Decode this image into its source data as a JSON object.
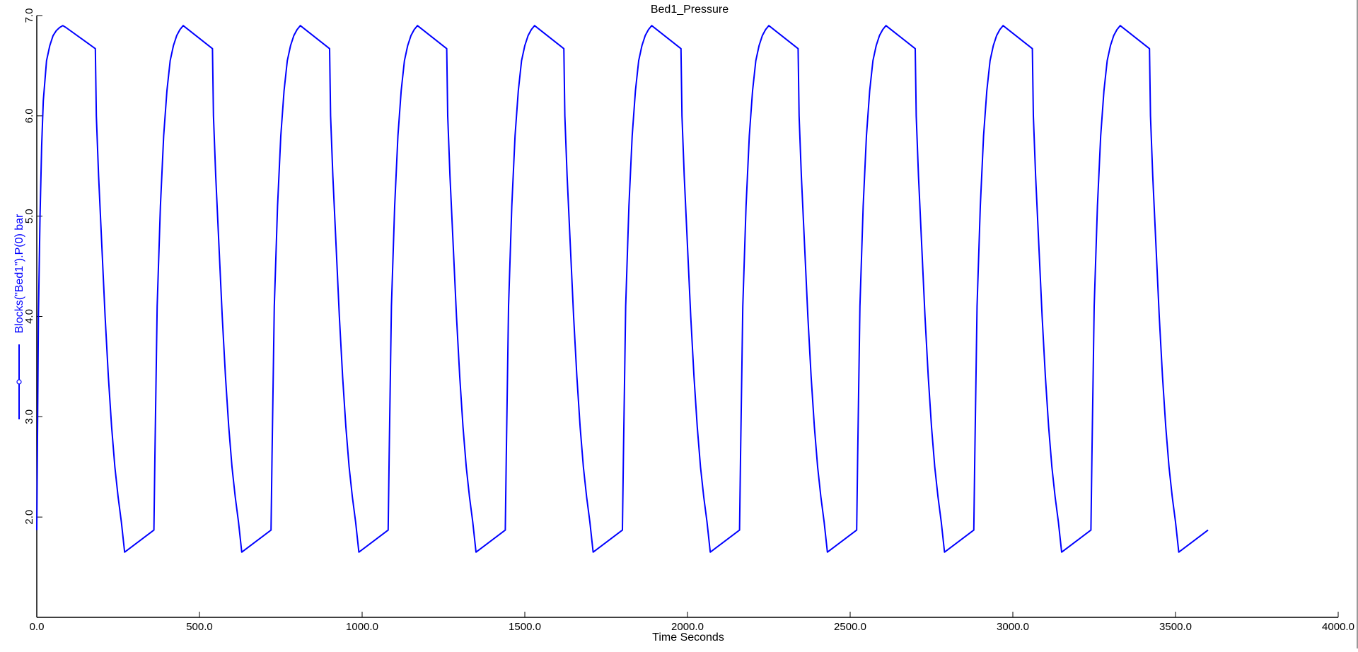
{
  "chart_data": {
    "type": "line",
    "title": "Bed1_Pressure",
    "xlabel": "Time Seconds",
    "ylabel": "Blocks(\"Bed1\").P(0) bar",
    "xlim": [
      0,
      4000
    ],
    "ylim": [
      1.0,
      7.0
    ],
    "x_ticks": [
      {
        "value": 0,
        "label": "0.0"
      },
      {
        "value": 500,
        "label": "500.0"
      },
      {
        "value": 1000,
        "label": "1000.0"
      },
      {
        "value": 1500,
        "label": "1500.0"
      },
      {
        "value": 2000,
        "label": "2000.0"
      },
      {
        "value": 2500,
        "label": "2500.0"
      },
      {
        "value": 3000,
        "label": "3000.0"
      },
      {
        "value": 3500,
        "label": "3500.0"
      },
      {
        "value": 4000,
        "label": "4000.0"
      }
    ],
    "y_ticks": [
      {
        "value": 2.0,
        "label": "2.0"
      },
      {
        "value": 3.0,
        "label": "3.0"
      },
      {
        "value": 4.0,
        "label": "4.0"
      },
      {
        "value": 5.0,
        "label": "5.0"
      },
      {
        "value": 6.0,
        "label": "6.0"
      },
      {
        "value": 7.0,
        "label": "7.0"
      }
    ],
    "grid": false,
    "series": [
      {
        "name": "Blocks(\"Bed1\").P(0) bar",
        "color": "#0000ff",
        "x": [
          0,
          2,
          5,
          10,
          15,
          20,
          30,
          40,
          50,
          60,
          70,
          80,
          90,
          180,
          183,
          190,
          200,
          210,
          220,
          230,
          240,
          250,
          260,
          270,
          360,
          363,
          370,
          380,
          390,
          400,
          410,
          420,
          430,
          440,
          450,
          540,
          543,
          550,
          560,
          570,
          580,
          590,
          600,
          610,
          620,
          630,
          720,
          723,
          730,
          740,
          750,
          760,
          770,
          780,
          790,
          800,
          810,
          900,
          903,
          910,
          920,
          930,
          940,
          950,
          960,
          970,
          980,
          990,
          1080,
          1083,
          1090,
          1100,
          1110,
          1120,
          1130,
          1140,
          1150,
          1160,
          1170,
          1260,
          1263,
          1270,
          1280,
          1290,
          1300,
          1310,
          1320,
          1330,
          1340,
          1350,
          1440,
          1443,
          1450,
          1460,
          1470,
          1480,
          1490,
          1500,
          1510,
          1520,
          1530,
          1620,
          1623,
          1630,
          1640,
          1650,
          1660,
          1670,
          1680,
          1690,
          1700,
          1710,
          1800,
          1803,
          1810,
          1820,
          1830,
          1840,
          1850,
          1860,
          1870,
          1880,
          1890,
          1980,
          1983,
          1990,
          2000,
          2010,
          2020,
          2030,
          2040,
          2050,
          2060,
          2070,
          2160,
          2163,
          2170,
          2180,
          2190,
          2200,
          2210,
          2220,
          2230,
          2240,
          2250,
          2340,
          2343,
          2350,
          2360,
          2370,
          2380,
          2390,
          2400,
          2410,
          2420,
          2430,
          2520,
          2523,
          2530,
          2540,
          2550,
          2560,
          2570,
          2580,
          2590,
          2600,
          2610,
          2700,
          2703,
          2710,
          2720,
          2730,
          2740,
          2750,
          2760,
          2770,
          2780,
          2790,
          2880,
          2883,
          2890,
          2900,
          2910,
          2920,
          2930,
          2940,
          2950,
          2960,
          2970,
          3060,
          3063,
          3070,
          3080,
          3090,
          3100,
          3110,
          3120,
          3130,
          3140,
          3150,
          3240,
          3243,
          3250,
          3260,
          3270,
          3280,
          3290,
          3300,
          3310,
          3320,
          3330,
          3420,
          3423,
          3430,
          3440,
          3450,
          3460,
          3470,
          3480,
          3490,
          3500,
          3510,
          3600
        ],
        "y": [
          1.87,
          2.7,
          4.0,
          5.0,
          5.7,
          6.15,
          6.55,
          6.7,
          6.8,
          6.85,
          6.88,
          6.9,
          6.88,
          6.67,
          6.0,
          5.4,
          4.7,
          4.0,
          3.4,
          2.9,
          2.5,
          2.2,
          1.95,
          1.65,
          1.87,
          2.6,
          4.1,
          5.1,
          5.8,
          6.25,
          6.55,
          6.7,
          6.8,
          6.86,
          6.9,
          6.67,
          6.0,
          5.4,
          4.7,
          4.0,
          3.4,
          2.9,
          2.5,
          2.2,
          1.95,
          1.65,
          1.87,
          2.6,
          4.1,
          5.1,
          5.8,
          6.25,
          6.55,
          6.7,
          6.8,
          6.86,
          6.9,
          6.67,
          6.0,
          5.4,
          4.7,
          4.0,
          3.4,
          2.9,
          2.5,
          2.2,
          1.95,
          1.65,
          1.87,
          2.6,
          4.1,
          5.1,
          5.8,
          6.25,
          6.55,
          6.7,
          6.8,
          6.86,
          6.9,
          6.67,
          6.0,
          5.4,
          4.7,
          4.0,
          3.4,
          2.9,
          2.5,
          2.2,
          1.95,
          1.65,
          1.87,
          2.6,
          4.1,
          5.1,
          5.8,
          6.25,
          6.55,
          6.7,
          6.8,
          6.86,
          6.9,
          6.67,
          6.0,
          5.4,
          4.7,
          4.0,
          3.4,
          2.9,
          2.5,
          2.2,
          1.95,
          1.65,
          1.87,
          2.6,
          4.1,
          5.1,
          5.8,
          6.25,
          6.55,
          6.7,
          6.8,
          6.86,
          6.9,
          6.67,
          6.0,
          5.4,
          4.7,
          4.0,
          3.4,
          2.9,
          2.5,
          2.2,
          1.95,
          1.65,
          1.87,
          2.6,
          4.1,
          5.1,
          5.8,
          6.25,
          6.55,
          6.7,
          6.8,
          6.86,
          6.9,
          6.67,
          6.0,
          5.4,
          4.7,
          4.0,
          3.4,
          2.9,
          2.5,
          2.2,
          1.95,
          1.65,
          1.87,
          2.6,
          4.1,
          5.1,
          5.8,
          6.25,
          6.55,
          6.7,
          6.8,
          6.86,
          6.9,
          6.67,
          6.0,
          5.4,
          4.7,
          4.0,
          3.4,
          2.9,
          2.5,
          2.2,
          1.95,
          1.65,
          1.87,
          2.6,
          4.1,
          5.1,
          5.8,
          6.25,
          6.55,
          6.7,
          6.8,
          6.86,
          6.9,
          6.67,
          6.0,
          5.4,
          4.7,
          4.0,
          3.4,
          2.9,
          2.5,
          2.2,
          1.95,
          1.65,
          1.87,
          2.6,
          4.1,
          5.1,
          5.8,
          6.25,
          6.55,
          6.7,
          6.8,
          6.86,
          6.9,
          6.67,
          6.0,
          5.4,
          4.7,
          4.0,
          3.4,
          2.9,
          2.5,
          2.2,
          1.95,
          1.65,
          1.87
        ]
      }
    ]
  }
}
